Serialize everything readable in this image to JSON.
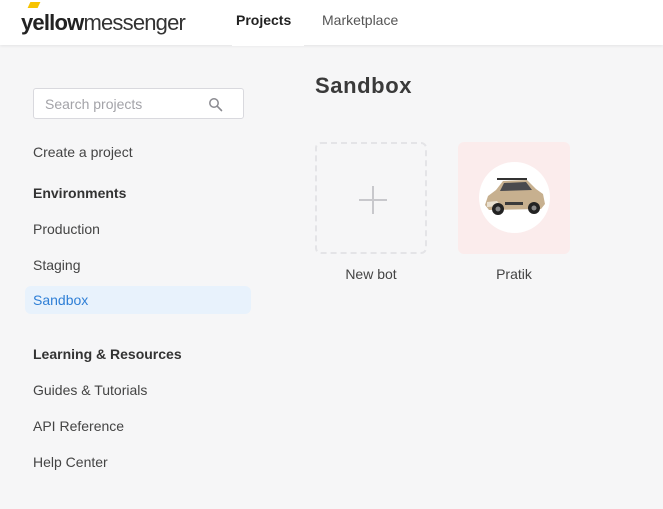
{
  "brand": {
    "logo_bold": "yellow",
    "logo_light": "messenger",
    "accent_color": "#f7c300"
  },
  "topnav": {
    "tabs": [
      {
        "label": "Projects",
        "active": true
      },
      {
        "label": "Marketplace",
        "active": false
      }
    ]
  },
  "sidebar": {
    "search_placeholder": "Search projects",
    "create_label": "Create a project",
    "environments": {
      "heading": "Environments",
      "items": [
        {
          "label": "Production"
        },
        {
          "label": "Staging"
        },
        {
          "label": "Sandbox",
          "active": true
        }
      ]
    },
    "resources": {
      "heading": "Learning & Resources",
      "items": [
        {
          "label": "Guides & Tutorials"
        },
        {
          "label": "API Reference"
        },
        {
          "label": "Help Center"
        }
      ]
    },
    "active_color": "#2f7fd6"
  },
  "main": {
    "title": "Sandbox",
    "cards": [
      {
        "label": "New bot",
        "icon": "plus-icon"
      },
      {
        "label": "Pratik",
        "icon": "car-avatar-icon"
      }
    ]
  }
}
